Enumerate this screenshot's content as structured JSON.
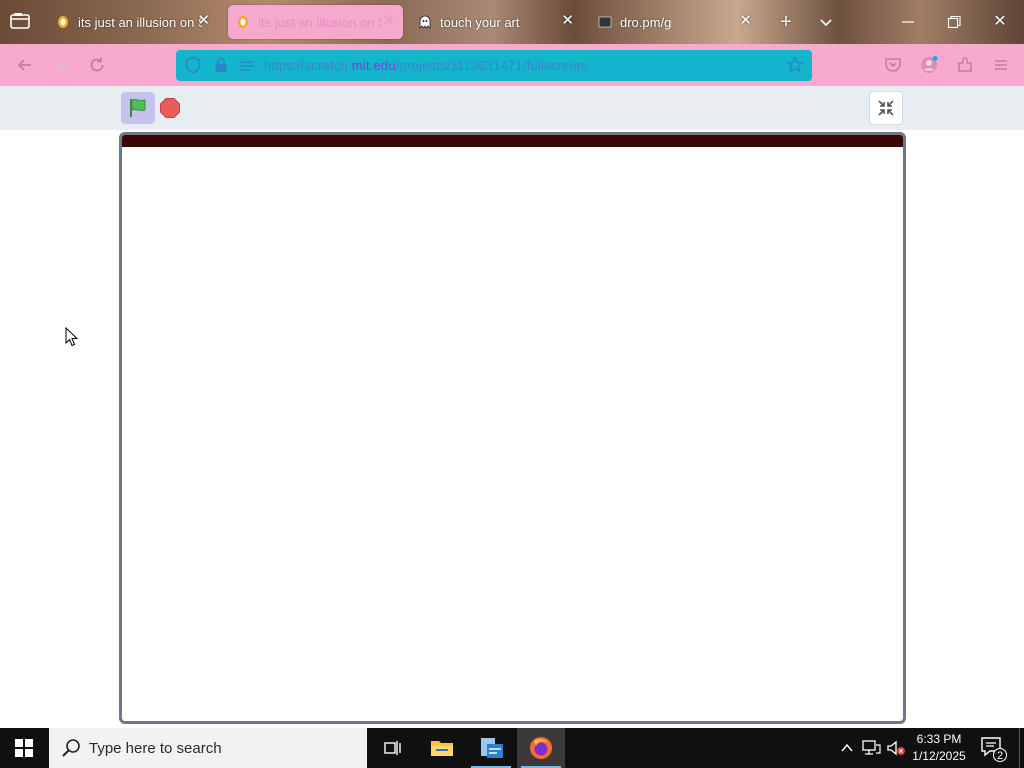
{
  "browser": {
    "tabs": [
      {
        "title": "its just an illusion on S",
        "favicon": "scratch-cat-icon",
        "active": false
      },
      {
        "title": "its just an illusion on S",
        "favicon": "scratch-cat-icon",
        "active": true
      },
      {
        "title": "touch your art",
        "favicon": "ghost-icon",
        "active": false
      },
      {
        "title": "dro.pm/g",
        "favicon": "page-icon",
        "active": false
      }
    ],
    "url": {
      "prefix": "https://scratch.",
      "domain": "mit.edu",
      "rest": "/projects/1113631471/fullscreen/"
    },
    "colors": {
      "navbar": "#f7a9cf",
      "urlbar": "#14b4cc",
      "active_tab": "#f6a9cf"
    }
  },
  "scratch": {
    "stage_top_color": "#3b0608",
    "flag_color": "#4cbf56",
    "stop_color": "#ec5959"
  },
  "taskbar": {
    "search_placeholder": "Type here to search",
    "time": "6:33 PM",
    "date": "1/12/2025",
    "notification_count": "2"
  }
}
